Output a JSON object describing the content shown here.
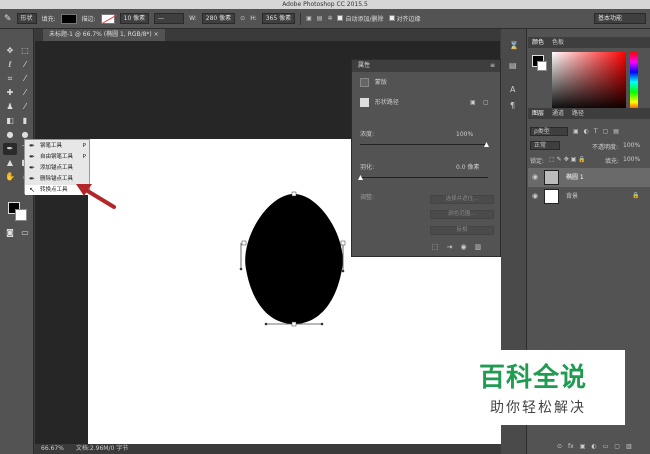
{
  "app": {
    "title": "Adobe Photoshop CC 2015.5"
  },
  "options": {
    "shape_mode": "形状",
    "fill_label": "填充:",
    "stroke_label": "描边:",
    "stroke_width": "10 像素",
    "width_label": "W:",
    "width_value": "280 像素",
    "height_label": "H:",
    "height_value": "365 像素",
    "auto_add_delete": "自动添加/删除",
    "align_edges": "对齐边缘",
    "workspace": "基本功能"
  },
  "document": {
    "tab_title": "未标题-1 @ 66.7% (椭圆 1, RGB/8*) ×"
  },
  "status": {
    "zoom": "66.67%",
    "doc_info": "文档:2.96M/0 字节"
  },
  "flyout": {
    "items": [
      {
        "label": "钢笔工具",
        "key": "P"
      },
      {
        "label": "自由钢笔工具",
        "key": "P"
      },
      {
        "label": "添加锚点工具",
        "key": ""
      },
      {
        "label": "删除锚点工具",
        "key": ""
      },
      {
        "label": "转换点工具",
        "key": ""
      }
    ]
  },
  "properties": {
    "title": "属性",
    "mask_label": "蒙版",
    "shape_path": "形状路径",
    "density_label": "浓度:",
    "density_value": "100%",
    "feather_label": "羽化:",
    "feather_value": "0.0 像素",
    "adjust_label": "调整:",
    "btn_select_mask": "选择并遮住...",
    "btn_color_range": "颜色范围...",
    "btn_invert": "反相"
  },
  "color_panel": {
    "tab_color": "颜色",
    "tab_swatches": "色板"
  },
  "layers_panel": {
    "tab_layers": "图层",
    "tab_channels": "通道",
    "tab_paths": "路径",
    "kind_filter": "ρ类型",
    "blend_mode": "正常",
    "opacity_label": "不透明度:",
    "opacity_value": "100%",
    "lock_label": "锁定:",
    "fill_label": "填充:",
    "fill_value": "100%",
    "layers": [
      {
        "name": "椭圆 1"
      },
      {
        "name": "背景"
      }
    ]
  },
  "watermark": {
    "title": "百科全说",
    "subtitle": "助你轻松解决"
  },
  "colors": {
    "accent_arrow": "#b3262a",
    "watermark_green": "#1f9c52"
  }
}
